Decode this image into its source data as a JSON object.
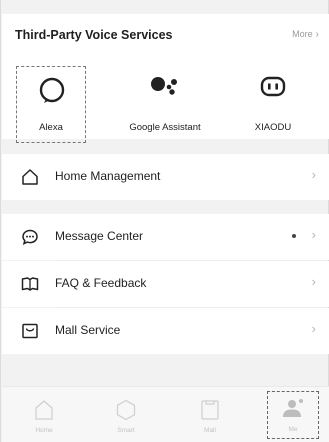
{
  "voice_services": {
    "title": "Third-Party Voice Services",
    "more_label": "More",
    "items": [
      {
        "label": "Alexa",
        "icon": "alexa-icon"
      },
      {
        "label": "Google Assistant",
        "icon": "google-assistant-icon"
      },
      {
        "label": "XIAODU",
        "icon": "xiaodu-icon"
      }
    ]
  },
  "menu": {
    "home_management": {
      "label": "Home Management",
      "icon": "house-icon"
    },
    "message_center": {
      "label": "Message Center",
      "icon": "chat-bubble-icon"
    },
    "faq_feedback": {
      "label": "FAQ & Feedback",
      "icon": "book-icon"
    },
    "mall_service": {
      "label": "Mall Service",
      "icon": "shop-icon"
    }
  },
  "tabbar": {
    "items": [
      {
        "label": "Home",
        "icon": "home-tab-icon"
      },
      {
        "label": "Smart",
        "icon": "hexagon-icon"
      },
      {
        "label": "Mall",
        "icon": "bag-icon"
      },
      {
        "label": "Me",
        "icon": "person-icon"
      }
    ]
  },
  "colors": {
    "background": "#f2f2f2",
    "card": "#ffffff",
    "text": "#1f1f1f",
    "muted": "#9a9a9a",
    "inactive_tab": "#c2c2c2"
  }
}
